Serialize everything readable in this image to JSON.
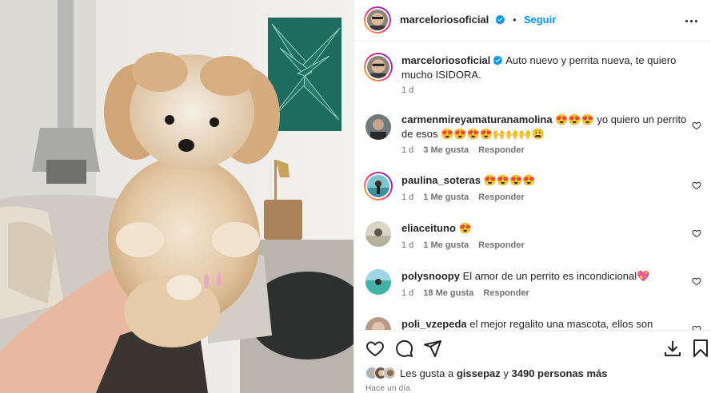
{
  "post": {
    "username": "marceloriosoficial",
    "verified": true,
    "dot": "•",
    "follow_label": "Seguir",
    "more_icon": "more-horizontal-icon"
  },
  "caption": {
    "username": "marceloriosoficial",
    "text": "Auto nuevo y perrita nueva, te quiero mucho ISIDORA.",
    "time": "1 d"
  },
  "comments": [
    {
      "username": "carmenmireyamaturanamolina",
      "text": "😍😍😍 yo quiero un perrito de esos 😍😍😍😍🙌🙌🙌😩",
      "time": "1 d",
      "likes": "3 Me gusta",
      "reply": "Responder"
    },
    {
      "username": "paulina_soteras",
      "text": "😍😍😍😍",
      "time": "1 d",
      "likes": "1 Me gusta",
      "reply": "Responder"
    },
    {
      "username": "eliaceituno",
      "text": "😍",
      "time": "1 d",
      "likes": "1 Me gusta",
      "reply": "Responder"
    },
    {
      "username": "polysnoopy",
      "text": "El amor de un perrito es incondicional💖",
      "time": "1 d",
      "likes": "18 Me gusta",
      "reply": "Responder"
    },
    {
      "username": "poli_vzepeda",
      "text": "el mejor regalito una mascota, ellos son",
      "time": "",
      "likes": "",
      "reply": ""
    }
  ],
  "actions": {
    "like_icon": "heart-outline-icon",
    "comment_icon": "comment-icon",
    "share_icon": "send-icon",
    "download_icon": "download-icon",
    "save_icon": "bookmark-icon"
  },
  "likes": {
    "prefix": "Les gusta a",
    "user": "gissepaz",
    "conj": "y",
    "count": "3490 personas más"
  },
  "timestamp": "Hace un día",
  "colors": {
    "link": "#0095f6",
    "verified": "#0095f6",
    "muted": "#737373",
    "text": "#262626"
  }
}
